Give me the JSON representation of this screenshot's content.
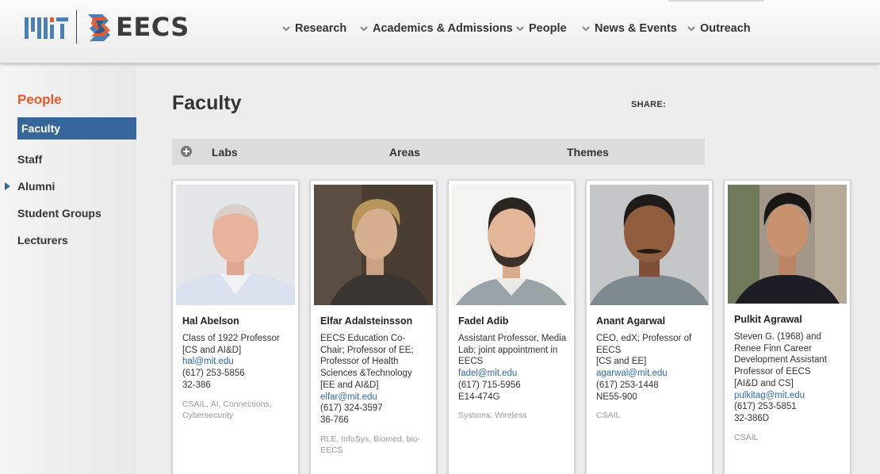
{
  "header": {
    "logo_mit": "MIT",
    "logo_eecs": "EECS",
    "nav": [
      {
        "label": "Research"
      },
      {
        "label": "Academics & Admissions"
      },
      {
        "label": "People"
      },
      {
        "label": "News & Events"
      },
      {
        "label": "Outreach"
      }
    ]
  },
  "sidebar": {
    "heading": "People",
    "active": "Faculty",
    "items": [
      {
        "label": "Staff"
      },
      {
        "label": "Alumni"
      },
      {
        "label": "Student Groups"
      },
      {
        "label": "Lecturers"
      }
    ]
  },
  "main": {
    "title": "Faculty",
    "share_label": "SHARE:",
    "filters": [
      {
        "label": "Labs"
      },
      {
        "label": "Areas"
      },
      {
        "label": "Themes"
      }
    ]
  },
  "faculty": [
    {
      "name": "Hal Abelson",
      "title_lines": [
        "Class of 1922 Professor",
        "[CS and AI&D]"
      ],
      "email": "hal@mit.edu",
      "phone": "(617) 253-5856",
      "office": "32-386",
      "tags": "CSAIL, AI, Connections, Cybersecurity"
    },
    {
      "name": "Elfar Adalsteinsson",
      "title_lines": [
        "EECS Education Co-Chair; Professor of EE; Professor of Health Sciences &Technology",
        "[EE and AI&D]"
      ],
      "email": "elfar@mit.edu",
      "phone": "(617) 324-3597",
      "office": "36-766",
      "tags": "RLE, InfoSys, Biomed, bio-EECS"
    },
    {
      "name": "Fadel Adib",
      "title_lines": [
        "Assistant Professor, Media Lab; joint appointment in EECS"
      ],
      "email": "fadel@mit.edu",
      "phone": "(617) 715-5956",
      "office": "E14-474G",
      "tags": "Systems, Wireless"
    },
    {
      "name": "Anant Agarwal",
      "title_lines": [
        "CEO, edX; Professor of EECS",
        "[CS and EE]"
      ],
      "email": "agarwal@mit.edu",
      "phone": "(617) 253-1448",
      "office": "NE55-900",
      "tags": "CSAIL"
    },
    {
      "name": "Pulkit Agrawal",
      "title_lines": [
        "Steven G. (1968) and Renee Finn Career Development Assistant Professor of EECS",
        "[AI&D and CS]"
      ],
      "email": "pulkitag@mit.edu",
      "phone": "(617) 253-5851",
      "office": "32-386D",
      "tags": "CSAIL"
    }
  ],
  "colors": {
    "accent_orange": "#e9582a",
    "active_blue": "#37679a",
    "link_blue": "#2f6ba8"
  }
}
